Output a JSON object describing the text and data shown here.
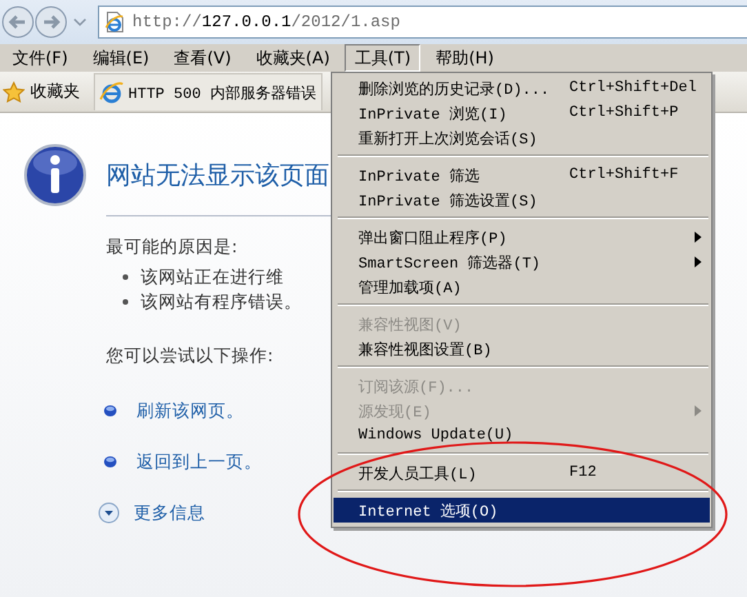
{
  "address_bar": {
    "url": "http://**127.0.0.1**/2012/1.asp"
  },
  "menu_bar": [
    {
      "label": "文件(F)",
      "selected": false
    },
    {
      "label": "编辑(E)",
      "selected": false
    },
    {
      "label": "查看(V)",
      "selected": false
    },
    {
      "label": "收藏夹(A)",
      "selected": false
    },
    {
      "label": "工具(T)",
      "selected": true
    },
    {
      "label": "帮助(H)",
      "selected": false
    }
  ],
  "favorites_bar": {
    "label": "收藏夹",
    "tab": "HTTP 500 内部服务器错误"
  },
  "page": {
    "title": "网站无法显示该页面",
    "causes_heading": "最可能的原因是:",
    "causes": [
      "该网站正在进行维",
      "该网站有程序错误。"
    ],
    "actions_heading": "您可以尝试以下操作:",
    "actions": [
      "刷新该网页。",
      "返回到上一页。"
    ],
    "more_info": "更多信息"
  },
  "tools_menu": [
    {
      "kind": "item",
      "label": "删除浏览的历史记录(D)...",
      "shortcut": "Ctrl+Shift+Del",
      "disabled": false,
      "submenu": false,
      "selected": false
    },
    {
      "kind": "item",
      "label": "InPrivate 浏览(I)",
      "shortcut": "Ctrl+Shift+P",
      "disabled": false,
      "submenu": false,
      "selected": false
    },
    {
      "kind": "item",
      "label": "重新打开上次浏览会话(S)",
      "disabled": false,
      "submenu": false,
      "selected": false
    },
    {
      "kind": "separator"
    },
    {
      "kind": "item",
      "label": "InPrivate 筛选",
      "shortcut": "Ctrl+Shift+F",
      "disabled": false,
      "submenu": false,
      "selected": false
    },
    {
      "kind": "item",
      "label": "InPrivate 筛选设置(S)",
      "disabled": false,
      "submenu": false,
      "selected": false
    },
    {
      "kind": "separator"
    },
    {
      "kind": "item",
      "label": "弹出窗口阻止程序(P)",
      "disabled": false,
      "submenu": true,
      "selected": false
    },
    {
      "kind": "item",
      "label": "SmartScreen 筛选器(T)",
      "disabled": false,
      "submenu": true,
      "selected": false
    },
    {
      "kind": "item",
      "label": "管理加载项(A)",
      "disabled": false,
      "submenu": false,
      "selected": false
    },
    {
      "kind": "separator"
    },
    {
      "kind": "item",
      "label": "兼容性视图(V)",
      "disabled": true,
      "submenu": false,
      "selected": false
    },
    {
      "kind": "item",
      "label": "兼容性视图设置(B)",
      "disabled": false,
      "submenu": false,
      "selected": false
    },
    {
      "kind": "separator"
    },
    {
      "kind": "item",
      "label": "订阅该源(F)...",
      "disabled": true,
      "submenu": false,
      "selected": false
    },
    {
      "kind": "item",
      "label": "源发现(E)",
      "disabled": true,
      "submenu": true,
      "selected": false
    },
    {
      "kind": "item",
      "label": "Windows Update(U)",
      "disabled": false,
      "submenu": false,
      "selected": false
    },
    {
      "kind": "separator"
    },
    {
      "kind": "item",
      "label": "开发人员工具(L)",
      "shortcut": "F12",
      "disabled": false,
      "submenu": false,
      "selected": false
    },
    {
      "kind": "separator"
    },
    {
      "kind": "item",
      "label": "Internet 选项(O)",
      "disabled": false,
      "submenu": false,
      "selected": true
    }
  ]
}
